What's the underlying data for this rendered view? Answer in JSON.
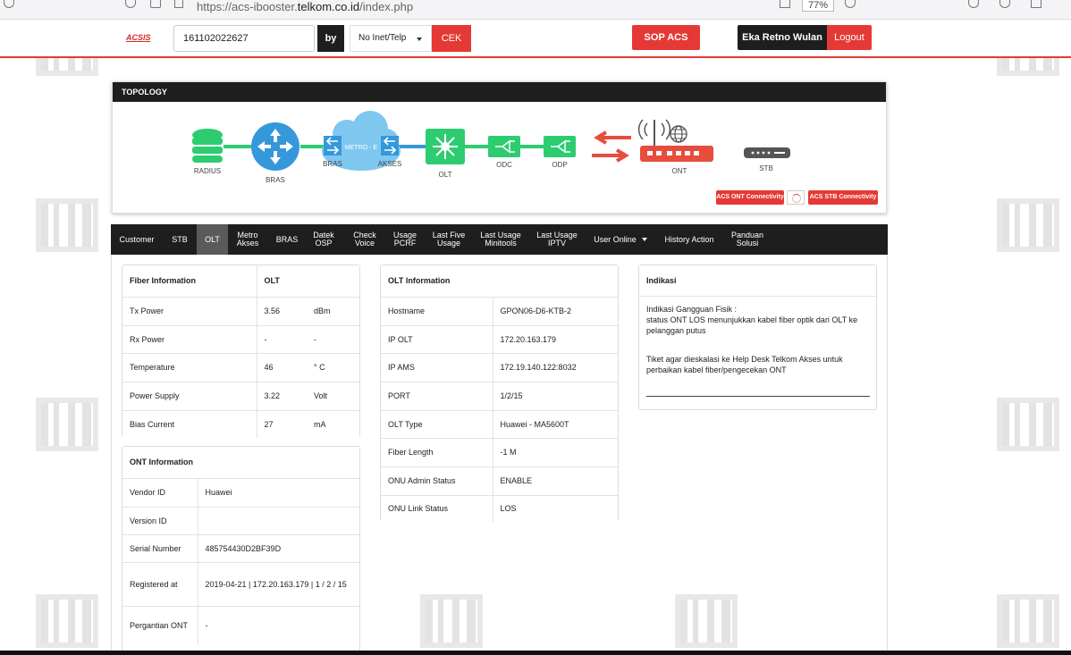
{
  "browser": {
    "url_prefix": "https://acs-ibooster.",
    "url_domain": "telkom.co.id",
    "url_path": "/index.php",
    "zoom": "77%"
  },
  "header": {
    "logo": "ACSIS",
    "search_value": "161102022627",
    "by_label": "by",
    "search_by": "No Inet/Telp",
    "cek_label": "CEK",
    "sop_label": "SOP ACS",
    "user_name": "Eka Retno Wulan",
    "logout_label": "Logout"
  },
  "topology": {
    "title": "TOPOLOGY",
    "nodes": {
      "radius": "RADIUS",
      "bras": "BRAS",
      "bras_switch": "BRAS",
      "metro": "METRO - E",
      "akses": "AKSES",
      "olt": "OLT",
      "odc": "ODC",
      "odp": "ODP",
      "ont": "ONT",
      "stb": "STB"
    },
    "acs_ont_label": "ACS ONT Connectivity",
    "acs_stb_label": "ACS STB Connectivity",
    "colors": {
      "green": "#2ecc71",
      "blue": "#3498db",
      "red": "#e74c3c",
      "dark": "#555555"
    }
  },
  "tabs": [
    {
      "label": "Customer"
    },
    {
      "label": "STB"
    },
    {
      "label": "OLT",
      "active": true
    },
    {
      "label": "Metro\nAkses"
    },
    {
      "label": "BRAS"
    },
    {
      "label": "Datek\nOSP"
    },
    {
      "label": "Check\nVoice"
    },
    {
      "label": "Usage\nPCRF"
    },
    {
      "label": "Last Five\nUsage"
    },
    {
      "label": "Last Usage\nMinitools"
    },
    {
      "label": "Last Usage\nIPTV"
    },
    {
      "label": "User Online"
    },
    {
      "label": "History Action"
    },
    {
      "label": "Panduan\nSolusi"
    }
  ],
  "fiber": {
    "header": [
      "Fiber Information",
      "OLT",
      ""
    ],
    "rows": [
      [
        "Tx Power",
        "3.56",
        "dBm"
      ],
      [
        "Rx Power",
        "-",
        "-"
      ],
      [
        "Temperature",
        "46",
        "° C"
      ],
      [
        "Power Supply",
        "3.22",
        "Volt"
      ],
      [
        "Bias Current",
        "27",
        "mA"
      ]
    ]
  },
  "ont": {
    "header": "ONT Information",
    "rows": [
      [
        "Vendor ID",
        "Huawei"
      ],
      [
        "Version ID",
        ""
      ],
      [
        "Serial Number",
        "485754430D2BF39D"
      ],
      [
        "Registered at",
        "2019-04-21 | 172.20.163.179 | 1 / 2 / 15"
      ],
      [
        "Pergantian ONT",
        "-"
      ]
    ]
  },
  "olt": {
    "header": "OLT Information",
    "rows": [
      [
        "Hostname",
        "GPON06-D6-KTB-2"
      ],
      [
        "IP OLT",
        "172.20.163.179"
      ],
      [
        "IP AMS",
        "172.19.140.122:8032"
      ],
      [
        "PORT",
        "1/2/15"
      ],
      [
        "OLT Type",
        "Huawei - MA5600T"
      ],
      [
        "Fiber Length",
        "-1 M"
      ],
      [
        "ONU Admin Status",
        "ENABLE"
      ],
      [
        "ONU Link Status",
        "LOS"
      ]
    ]
  },
  "indikasi": {
    "title": "Indikasi",
    "line1": "Indikasi Gangguan Fisik :",
    "line2": "status ONT LOS menunjukkan kabel fiber optik dari OLT ke pelanggan putus",
    "line3": "Tiket agar dieskalasi ke Help Desk Telkom Akses untuk perbaikan kabel fiber/pengecekan ONT"
  }
}
